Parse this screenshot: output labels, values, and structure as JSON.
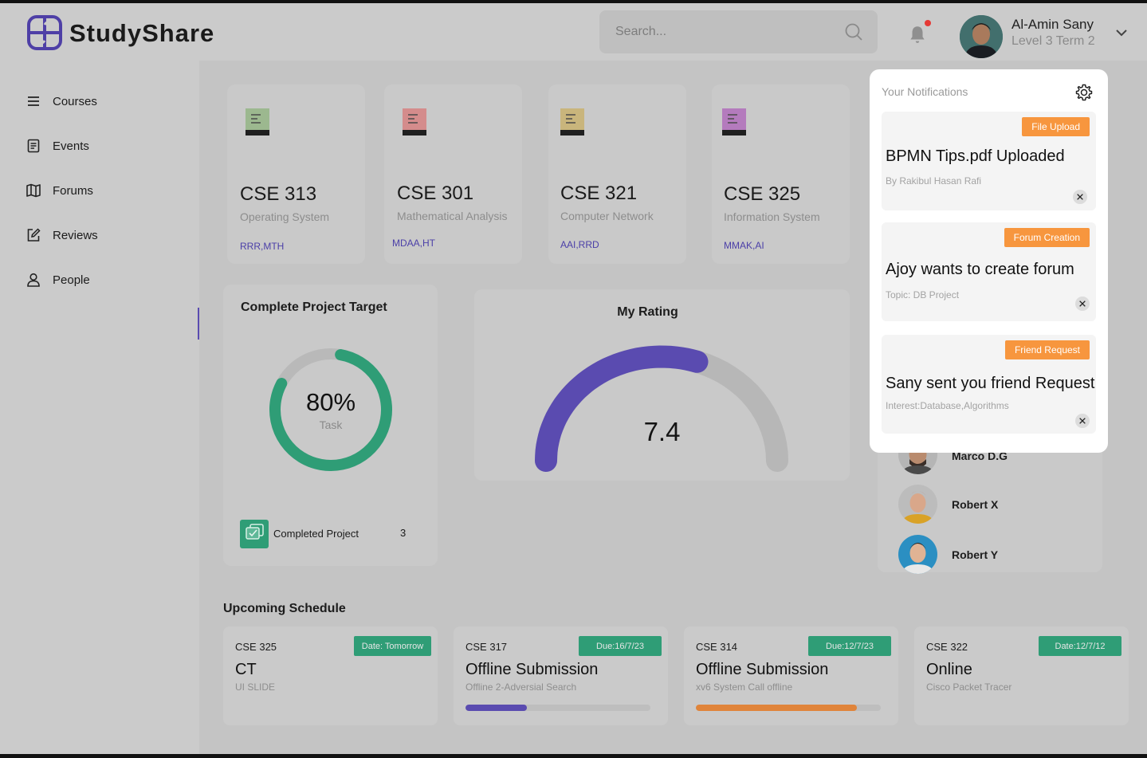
{
  "app": {
    "name": "StudyShare"
  },
  "search": {
    "placeholder": "Search..."
  },
  "user": {
    "name": "Al-Amin Sany",
    "level": "Level 3 Term 2"
  },
  "sidebar": {
    "items": [
      {
        "label": "Courses",
        "icon": "menu-icon"
      },
      {
        "label": "Events",
        "icon": "document-icon"
      },
      {
        "label": "Forums",
        "icon": "map-icon"
      },
      {
        "label": "Reviews",
        "icon": "edit-icon"
      },
      {
        "label": "People",
        "icon": "person-icon"
      }
    ]
  },
  "courses": [
    {
      "code": "CSE 313",
      "name": "Operating System",
      "tags": "RRR,MTH",
      "color": "#9cb88f"
    },
    {
      "code": "CSE 301",
      "name": "Mathematical Analysis",
      "tags": "MDAA,HT",
      "color": "#d48c8c"
    },
    {
      "code": "CSE 321",
      "name": "Computer Network",
      "tags": "AAI,RRD",
      "color": "#c9b57c"
    },
    {
      "code": "CSE 325",
      "name": "Information System",
      "tags": "MMAK,AI",
      "color": "#b47bbd"
    }
  ],
  "project": {
    "title": "Complete Project Target",
    "percent_label": "80%",
    "percent_value": 0.8,
    "sub_label": "Task",
    "completed_label": "Completed Project",
    "completed_count": "3"
  },
  "rating": {
    "title": "My Rating",
    "value": "7.4",
    "max": 10
  },
  "notifications": {
    "title": "Your Notifications",
    "items": [
      {
        "badge": "File Upload",
        "heading": "BPMN Tips.pdf Uploaded",
        "sub": "By Rakibul Hasan Rafi"
      },
      {
        "badge": "Forum Creation",
        "heading": "Ajoy wants to create forum",
        "sub": "Topic: DB Project"
      },
      {
        "badge": "Friend Request",
        "heading": "Sany sent you friend Request",
        "sub": "Interest:Database,Algorithms"
      }
    ]
  },
  "friends": [
    {
      "name": "Marco D.G"
    },
    {
      "name": "Robert X"
    },
    {
      "name": "Robert Y"
    }
  ],
  "schedule": {
    "title": "Upcoming Schedule",
    "items": [
      {
        "code": "CSE 325",
        "badge": "Date: Tomorrow",
        "title": "CT",
        "sub": "UI SLIDE"
      },
      {
        "code": "CSE 317",
        "badge": "Due:16/7/23",
        "title": "Offline Submission",
        "sub": "Offline 2-Adversial Search",
        "progress": 0.33,
        "progress_color": "#5a4bb0"
      },
      {
        "code": "CSE 314",
        "badge": "Due:12/7/23",
        "title": "Offline Submission",
        "sub": "xv6 System Call offline",
        "progress": 0.87,
        "progress_color": "#e0843a"
      },
      {
        "code": "CSE 322",
        "badge": "Date:12/7/12",
        "title": "Online",
        "sub": "Cisco Packet Tracer"
      }
    ]
  },
  "colors": {
    "accent": "#5a4bb0",
    "green": "#2f9d76",
    "orange": "#f7963e"
  }
}
